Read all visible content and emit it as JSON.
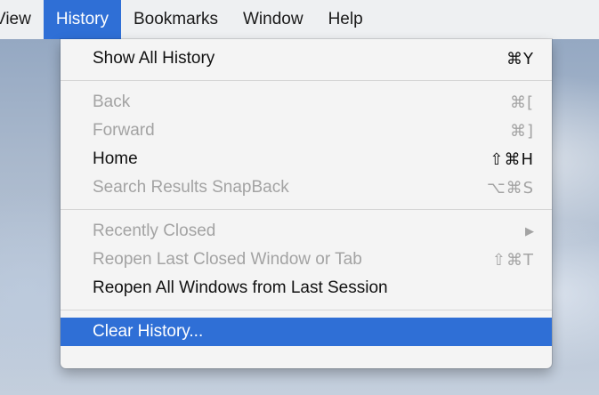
{
  "menubar": {
    "items": [
      {
        "label": "View"
      },
      {
        "label": "History"
      },
      {
        "label": "Bookmarks"
      },
      {
        "label": "Window"
      },
      {
        "label": "Help"
      }
    ]
  },
  "history_menu": {
    "show_all_history": {
      "label": "Show All History",
      "shortcut": "⌘Y"
    },
    "back": {
      "label": "Back",
      "shortcut": "⌘["
    },
    "forward": {
      "label": "Forward",
      "shortcut": "⌘]"
    },
    "home": {
      "label": "Home",
      "shortcut": "⇧⌘H"
    },
    "search_results_snapback": {
      "label": "Search Results SnapBack",
      "shortcut": "⌥⌘S"
    },
    "recently_closed": {
      "label": "Recently Closed",
      "arrow": "▶"
    },
    "reopen_last_closed": {
      "label": "Reopen Last Closed Window or Tab",
      "shortcut": "⇧⌘T"
    },
    "reopen_all_windows": {
      "label": "Reopen All Windows from Last Session"
    },
    "clear_history": {
      "label": "Clear History..."
    }
  },
  "colors": {
    "selection": "#2f6fd6",
    "disabled_text": "#a3a3a3",
    "menu_background": "#f4f4f4"
  }
}
